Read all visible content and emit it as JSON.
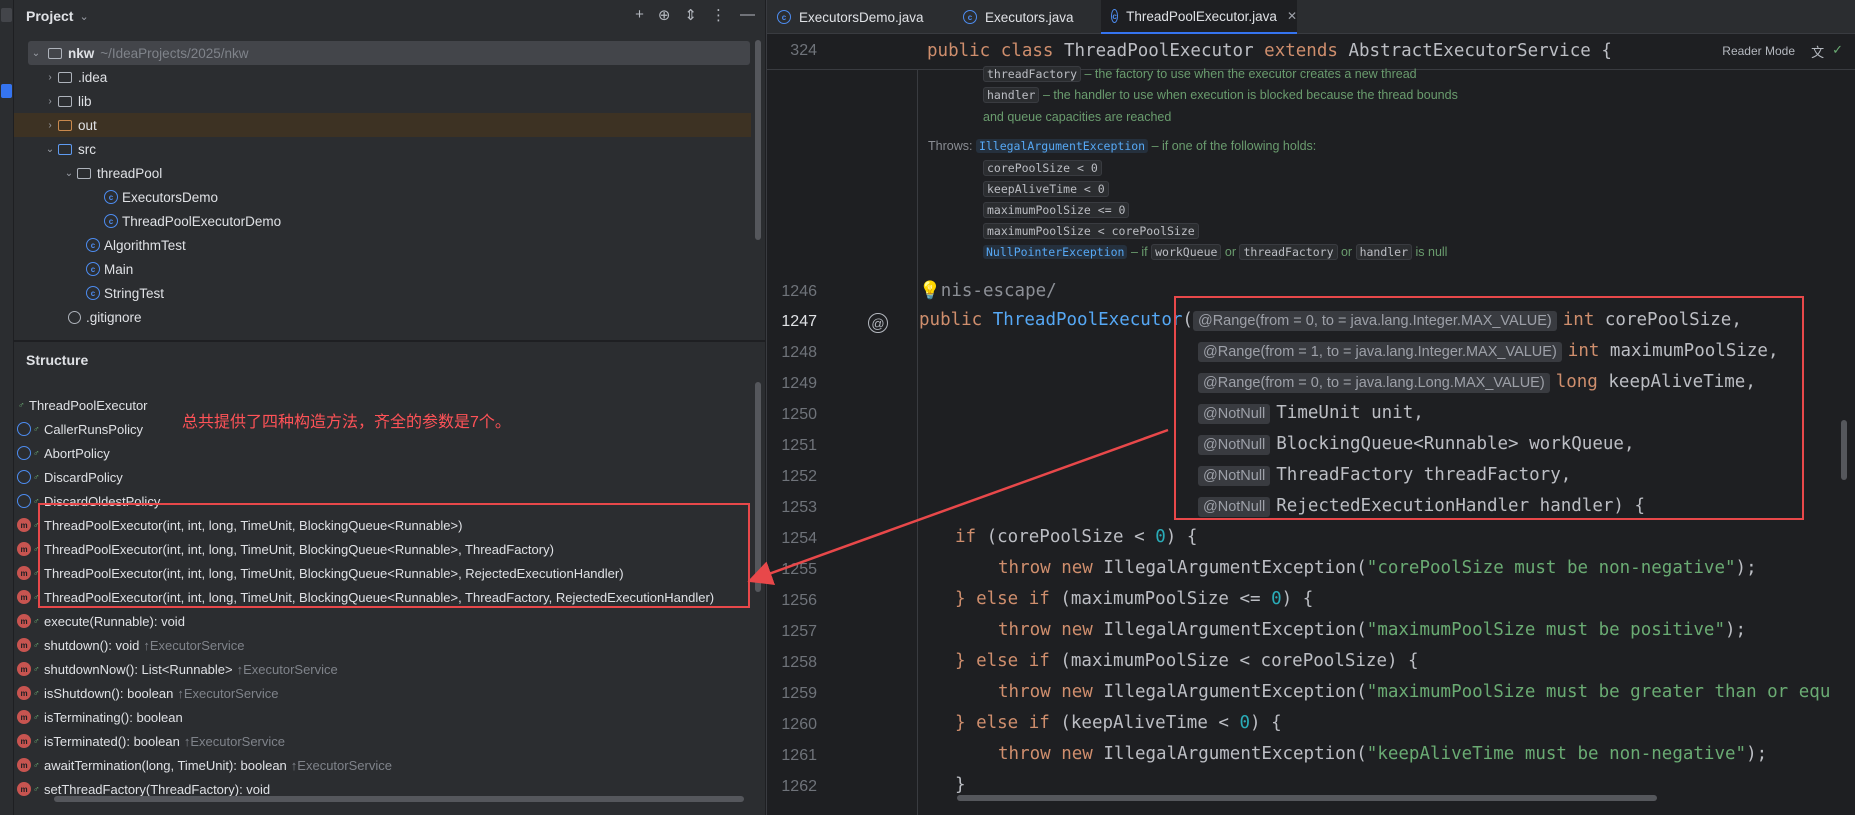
{
  "project_panel": {
    "title": "Project",
    "tree": [
      {
        "label": "nkw",
        "path": "~/IdeaProjects/2025/nkw"
      },
      {
        "label": ".idea"
      },
      {
        "label": "lib"
      },
      {
        "label": "out"
      },
      {
        "label": "src"
      },
      {
        "label": "threadPool"
      },
      {
        "label": "ExecutorsDemo"
      },
      {
        "label": "ThreadPoolExecutorDemo"
      },
      {
        "label": "AlgorithmTest"
      },
      {
        "label": "Main"
      },
      {
        "label": "StringTest"
      },
      {
        "label": ".gitignore"
      }
    ]
  },
  "structure_panel": {
    "title": "Structure",
    "note": "总共提供了四种构造方法，齐全的参数是7个。",
    "items": [
      {
        "label": "ThreadPoolExecutor",
        "inherited": ""
      },
      {
        "label": "CallerRunsPolicy",
        "inherited": ""
      },
      {
        "label": "AbortPolicy",
        "inherited": ""
      },
      {
        "label": "DiscardPolicy",
        "inherited": ""
      },
      {
        "label": "DiscardOldestPolicy",
        "inherited": ""
      },
      {
        "label": "ThreadPoolExecutor(int, int, long, TimeUnit, BlockingQueue<Runnable>)",
        "inherited": ""
      },
      {
        "label": "ThreadPoolExecutor(int, int, long, TimeUnit, BlockingQueue<Runnable>, ThreadFactory)",
        "inherited": ""
      },
      {
        "label": "ThreadPoolExecutor(int, int, long, TimeUnit, BlockingQueue<Runnable>, RejectedExecutionHandler)",
        "inherited": ""
      },
      {
        "label": "ThreadPoolExecutor(int, int, long, TimeUnit, BlockingQueue<Runnable>, ThreadFactory, RejectedExecutionHandler)",
        "inherited": ""
      },
      {
        "label": "execute(Runnable): void",
        "inherited": ""
      },
      {
        "label": "shutdown(): void",
        "inherited": "↑ExecutorService"
      },
      {
        "label": "shutdownNow(): List<Runnable>",
        "inherited": "↑ExecutorService"
      },
      {
        "label": "isShutdown(): boolean",
        "inherited": "↑ExecutorService"
      },
      {
        "label": "isTerminating(): boolean",
        "inherited": ""
      },
      {
        "label": "isTerminated(): boolean",
        "inherited": "↑ExecutorService"
      },
      {
        "label": "awaitTermination(long, TimeUnit): boolean",
        "inherited": "↑ExecutorService"
      },
      {
        "label": "setThreadFactory(ThreadFactory): void",
        "inherited": ""
      }
    ]
  },
  "editor": {
    "tabs": [
      {
        "label": "ExecutorsDemo.java"
      },
      {
        "label": "Executors.java"
      },
      {
        "label": "ThreadPoolExecutor.java",
        "close": "✕"
      }
    ],
    "reader_mode": "Reader Mode",
    "sticky_line": "324",
    "sticky_code": {
      "kw1": "public class",
      "name": " ThreadPoolExecutor ",
      "kw2": "extends",
      "rest": " AbstractExecutorService {"
    },
    "javadoc": {
      "thread_factory_code": "threadFactory",
      "thread_factory_text": " – the factory to use when the executor creates a new thread",
      "handler_code": "handler",
      "handler_text": " – the handler to use when execution is blocked because the thread bounds",
      "handler_text2": "and queue capacities are reached",
      "throws_label": "Throws:",
      "throws_exc": "IllegalArgumentException",
      "throws_text": " – if one of the following holds:",
      "conds": [
        "corePoolSize < 0",
        "keepAliveTime < 0",
        "maximumPoolSize <= 0",
        "maximumPoolSize < corePoolSize"
      ],
      "npe": "NullPointerException",
      "npe_t1": " – if ",
      "npe_c1": "workQueue",
      "npe_t2": " or ",
      "npe_c2": "threadFactory",
      "npe_t3": " or ",
      "npe_c3": "handler",
      "npe_t4": " is null"
    },
    "lines": [
      {
        "num": "1246"
      },
      {
        "num": "1247"
      },
      {
        "num": "1248"
      },
      {
        "num": "1249"
      },
      {
        "num": "1250"
      },
      {
        "num": "1251"
      },
      {
        "num": "1252"
      },
      {
        "num": "1253"
      },
      {
        "num": "1254"
      },
      {
        "num": "1255"
      },
      {
        "num": "1256"
      },
      {
        "num": "1257"
      },
      {
        "num": "1258"
      },
      {
        "num": "1259"
      },
      {
        "num": "1260"
      },
      {
        "num": "1261"
      },
      {
        "num": "1262"
      }
    ],
    "code": {
      "l1246": "nis-escape/",
      "l1247_kw": "public",
      "l1247_fn": "ThreadPoolExecutor",
      "l1247_paren": "(",
      "hint1": "@Range(from = 0, to = java.lang.Integer.MAX_VALUE)",
      "p1_kw": "int",
      "p1": " corePoolSize,",
      "hint2": "@Range(from = 1, to = java.lang.Integer.MAX_VALUE)",
      "p2_kw": "int",
      "p2": " maximumPoolSize,",
      "hint3": "@Range(from = 0, to = java.lang.Long.MAX_VALUE)",
      "p3_kw": "long",
      "p3": " keepAliveTime,",
      "hint4": "@NotNull",
      "p4": "TimeUnit unit,",
      "p5": "BlockingQueue<Runnable> workQueue,",
      "p6": "ThreadFactory threadFactory,",
      "p7": "RejectedExecutionHandler handler) {",
      "if_kw": "if",
      "if_cond": " (corePoolSize < ",
      "zero": "0",
      "close_brace": ") {",
      "throw_kw": "throw",
      "new_kw": "new",
      "iae": " IllegalArgumentException(",
      "s1": "\"corePoolSize must be non-negative\"",
      "s2": "\"maximumPoolSize must be positive\"",
      "s3": "\"maximumPoolSize must be greater than or equ",
      "s4": "\"keepAliveTime must be non-negative\"",
      "end": ");",
      "else_kw": "} else if",
      "c2": " (maximumPoolSize <= ",
      "c3": " (maximumPoolSize < corePoolSize) {",
      "c4": " (keepAliveTime < ",
      "last_brace": "}"
    }
  }
}
